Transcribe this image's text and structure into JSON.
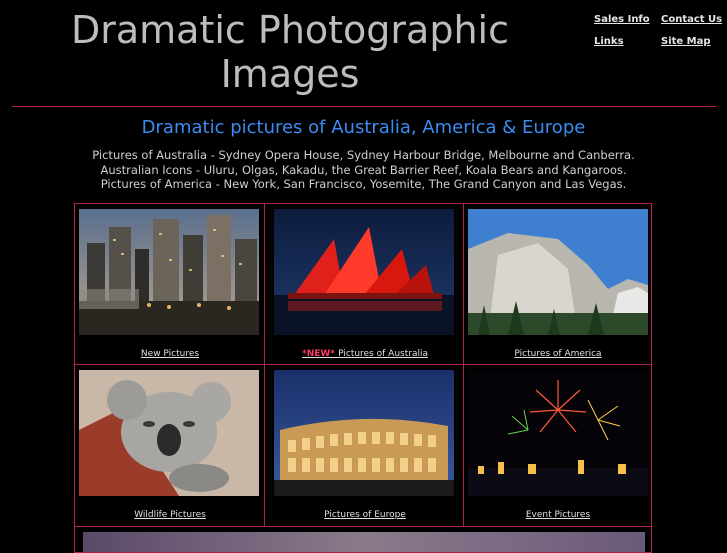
{
  "header": {
    "title_line1": "Dramatic Photographic",
    "title_line2": "Images"
  },
  "nav": {
    "sales_info": "Sales Info",
    "contact_us": "Contact Us",
    "links": "Links",
    "site_map": "Site Map"
  },
  "main": {
    "headline": "Dramatic pictures of Australia, America & Europe",
    "intro_lines": [
      "Pictures of Australia - Sydney Opera House, Sydney Harbour Bridge, Melbourne and Canberra.",
      "Australian Icons - Uluru, Olgas, Kakadu, the Great Barrier Reef, Koala Bears and Kangaroos.",
      "Pictures of America - New York, San Francisco, Yosemite, The Grand Canyon and Las Vegas."
    ]
  },
  "gallery": [
    {
      "caption": "New Pictures",
      "badge": ""
    },
    {
      "caption": "Pictures of Australia",
      "badge": "*NEW*"
    },
    {
      "caption": "Pictures of America",
      "badge": ""
    },
    {
      "caption": "Wildlife Pictures",
      "badge": ""
    },
    {
      "caption": "Pictures of Europe",
      "badge": ""
    },
    {
      "caption": "Event Pictures",
      "badge": ""
    }
  ],
  "colors": {
    "background": "#000000",
    "accent_border": "#b0244a",
    "headline": "#3b8cf0",
    "new_badge": "#ff3b6b"
  }
}
